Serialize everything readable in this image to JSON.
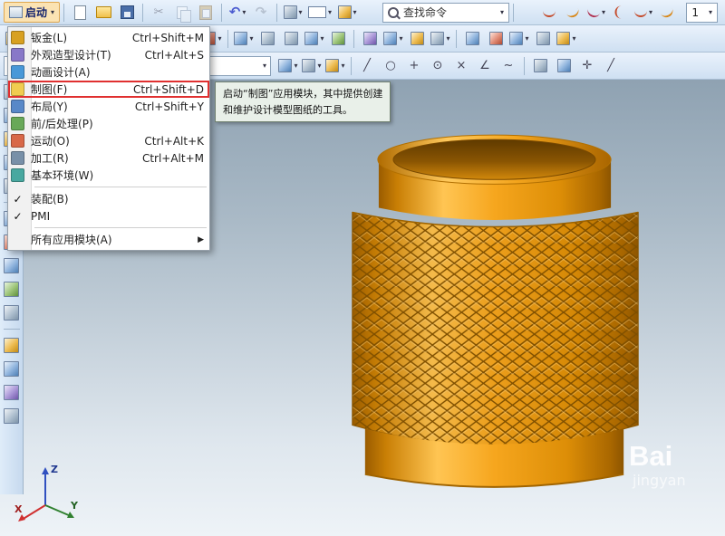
{
  "colors": {
    "annotation_red": "#e03030",
    "model_orange": "#f6a61e",
    "toolbar_blue": "#d6e6f5"
  },
  "icons": {
    "dropdown": "▾",
    "submenu_arrow": "▶",
    "check": "✓",
    "undo": "↶",
    "redo": "↷",
    "cut": "✂"
  },
  "toolbar": {
    "start_label": "启动",
    "search_placeholder": "查找命令",
    "view_scale_value": "1"
  },
  "menu": {
    "items": [
      {
        "label": "钣金(L)",
        "shortcut": "Ctrl+Shift+M"
      },
      {
        "label": "外观造型设计(T)",
        "shortcut": "Ctrl+Alt+S"
      },
      {
        "label": "动画设计(A)",
        "shortcut": ""
      },
      {
        "label": "制图(F)",
        "shortcut": "Ctrl+Shift+D",
        "highlighted": true
      },
      {
        "label": "布局(Y)",
        "shortcut": "Ctrl+Shift+Y"
      },
      {
        "label": "前/后处理(P)",
        "shortcut": ""
      },
      {
        "label": "运动(O)",
        "shortcut": "Ctrl+Alt+K"
      },
      {
        "label": "加工(R)",
        "shortcut": "Ctrl+Alt+M"
      },
      {
        "label": "基本环境(W)",
        "shortcut": ""
      },
      {
        "label": "装配(B)",
        "shortcut": "",
        "checked": true
      },
      {
        "label": "PMI",
        "shortcut": "",
        "checked": true
      },
      {
        "label": "所有应用模块(A)",
        "shortcut": "",
        "submenu": true
      }
    ]
  },
  "tooltip": {
    "line1": "启动“制图”应用模块，其中提供创建",
    "line2": "和维护设计模型图纸的工具。"
  },
  "viewport": {
    "watermark_line1": "Bai",
    "watermark_line2": "jingyan",
    "triad": {
      "z": "Z",
      "x": "X",
      "y": "Y"
    }
  }
}
